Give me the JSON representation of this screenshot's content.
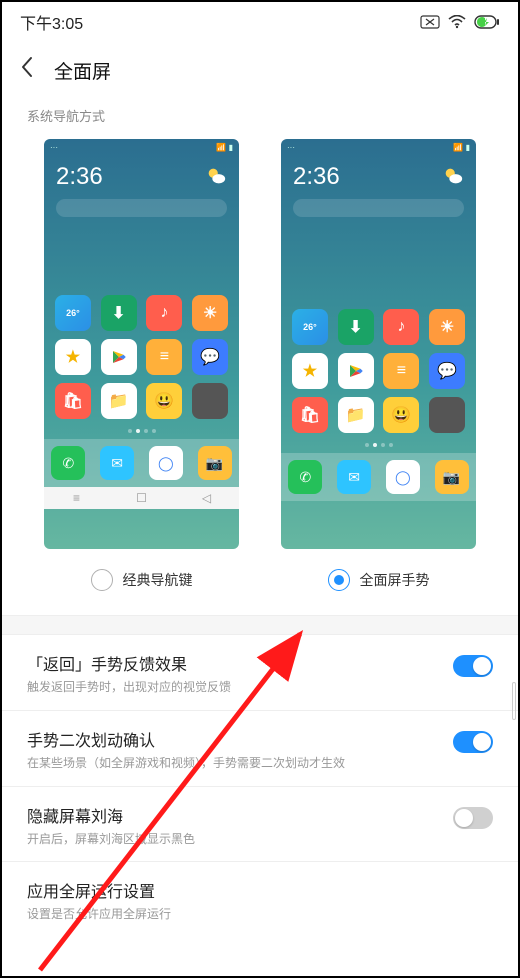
{
  "status": {
    "time": "下午3:05"
  },
  "header": {
    "title": "全面屏"
  },
  "section_label": "系统导航方式",
  "mock": {
    "time": "2:36"
  },
  "options": {
    "classic": "经典导航键",
    "gesture": "全面屏手势"
  },
  "settings": [
    {
      "title": "「返回」手势反馈效果",
      "sub": "触发返回手势时，出现对应的视觉反馈",
      "toggle": true
    },
    {
      "title": "手势二次划动确认",
      "sub": "在某些场景（如全屏游戏和视频），手势需要二次划动才生效",
      "toggle": true
    },
    {
      "title": "隐藏屏幕刘海",
      "sub": "开启后，屏幕刘海区域显示黑色",
      "toggle": false
    },
    {
      "title": "应用全屏运行设置",
      "sub": "设置是否允许应用全屏运行",
      "toggle": null
    }
  ]
}
